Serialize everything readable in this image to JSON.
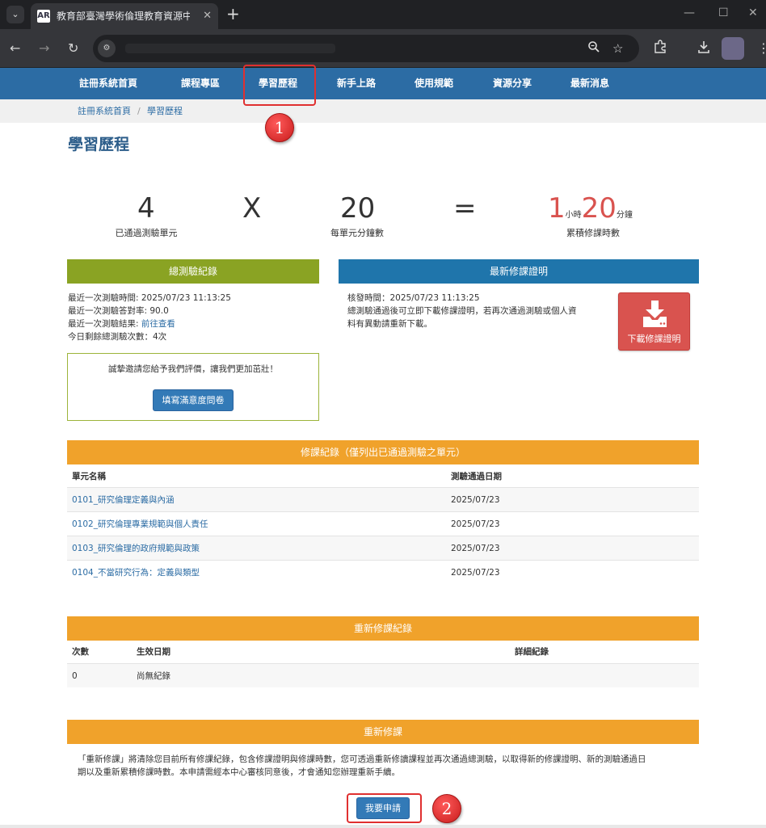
{
  "browser": {
    "tab_title": "教育部臺灣學術倫理教育資源中心",
    "favicon_text": "AR"
  },
  "nav": {
    "items": [
      "註冊系統首頁",
      "課程專區",
      "學習歷程",
      "新手上路",
      "使用規範",
      "資源分享",
      "最新消息"
    ],
    "active": "學習歷程"
  },
  "breadcrumb": {
    "home": "註冊系統首頁",
    "sep": "/",
    "current": "學習歷程"
  },
  "page": {
    "title": "學習歷程"
  },
  "annotations": [
    "1",
    "2"
  ],
  "summary": {
    "units": "4",
    "units_label": "已通過測驗單元",
    "times": "X",
    "minutes": "20",
    "minutes_label": "每單元分鐘數",
    "equals": "=",
    "hours": "1",
    "hours_unit": "小時",
    "mins": "20",
    "mins_unit": "分鐘",
    "total_label": "累積修課時數"
  },
  "exam": {
    "header": "總測驗紀錄",
    "last_time": "最近一次測驗時間: 2025/07/23 11:13:25",
    "last_rate": "最近一次測驗答對率: 90.0",
    "last_result_label": "最近一次測驗結果: ",
    "last_result_link": "前往查看",
    "remaining": "今日剩餘總測驗次數：4次",
    "invite_text": "誠摯邀請您給予我們評價，讓我們更加茁壯！",
    "survey_button": "填寫滿意度問卷"
  },
  "certificate": {
    "header": "最新修課證明",
    "issue_time": "核發時間：2025/07/23 11:13:25",
    "desc_line1": "總測驗通過後可立即下載修課證明，若再次通過測驗或個人資",
    "desc_line2": "料有異動請重新下載。",
    "download_button": "下載修課證明"
  },
  "course_records": {
    "header": "修課紀錄（僅列出已通過測驗之單元）",
    "columns": [
      "單元名稱",
      "測驗通過日期"
    ],
    "rows": [
      {
        "name": "0101_研究倫理定義與內涵",
        "date": "2025/07/23"
      },
      {
        "name": "0102_研究倫理專業規範與個人責任",
        "date": "2025/07/23"
      },
      {
        "name": "0103_研究倫理的政府規範與政策",
        "date": "2025/07/23"
      },
      {
        "name": "0104_不當研究行為：定義與類型",
        "date": "2025/07/23"
      }
    ]
  },
  "retake_records": {
    "header": "重新修課紀錄",
    "columns": [
      "次數",
      "生效日期",
      "詳細紀錄"
    ],
    "row": {
      "count": "0",
      "date": "尚無紀錄",
      "detail": ""
    }
  },
  "retake": {
    "header": "重新修課",
    "notice_line1": "「重新修課」將清除您目前所有修課紀錄，包含修課證明與修課時數，您可透過重新修讀課程並再次通過總測驗，以取得新的修課證明、新的測驗通過日",
    "notice_line2": "期以及重新累積修課時數。本申請需經本中心審核同意後，才會通知您辦理重新手續。",
    "apply_button": "我要申請"
  },
  "colors": {
    "nav": "#2c6ca4",
    "green_header": "#8aa323",
    "blue_header": "#1f75ab",
    "orange_header": "#f0a22b",
    "red_button": "#d9534f",
    "primary_button": "#337ab7",
    "annotation_red": "#e03030"
  }
}
